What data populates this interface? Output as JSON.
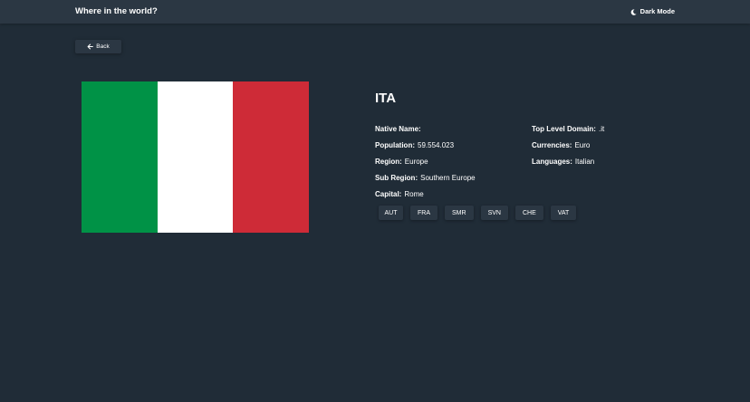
{
  "header": {
    "title": "Where in the world?",
    "dark_mode_label": "Dark Mode"
  },
  "back_button": {
    "label": "Back"
  },
  "country": {
    "name": "ITA",
    "flag_colors": [
      "#009246",
      "#ffffff",
      "#ce2b37"
    ],
    "left_info": [
      {
        "label": "Native Name:",
        "value": ""
      },
      {
        "label": "Population:",
        "value": "59.554.023"
      },
      {
        "label": "Region:",
        "value": "Europe"
      },
      {
        "label": "Sub Region:",
        "value": "Southern Europe"
      },
      {
        "label": "Capital:",
        "value": "Rome"
      }
    ],
    "right_info": [
      {
        "label": "Top Level Domain:",
        "value": ".it"
      },
      {
        "label": "Currencies:",
        "value": "Euro"
      },
      {
        "label": "Languages:",
        "value": "Italian"
      }
    ],
    "borders": [
      "AUT",
      "FRA",
      "SMR",
      "SVN",
      "CHE",
      "VAT"
    ]
  },
  "colors": {
    "background": "#202c37",
    "element": "#2b3743",
    "text": "#ffffff"
  },
  "icons": {
    "dark_mode": "moon-icon",
    "back": "arrow-left-icon"
  }
}
